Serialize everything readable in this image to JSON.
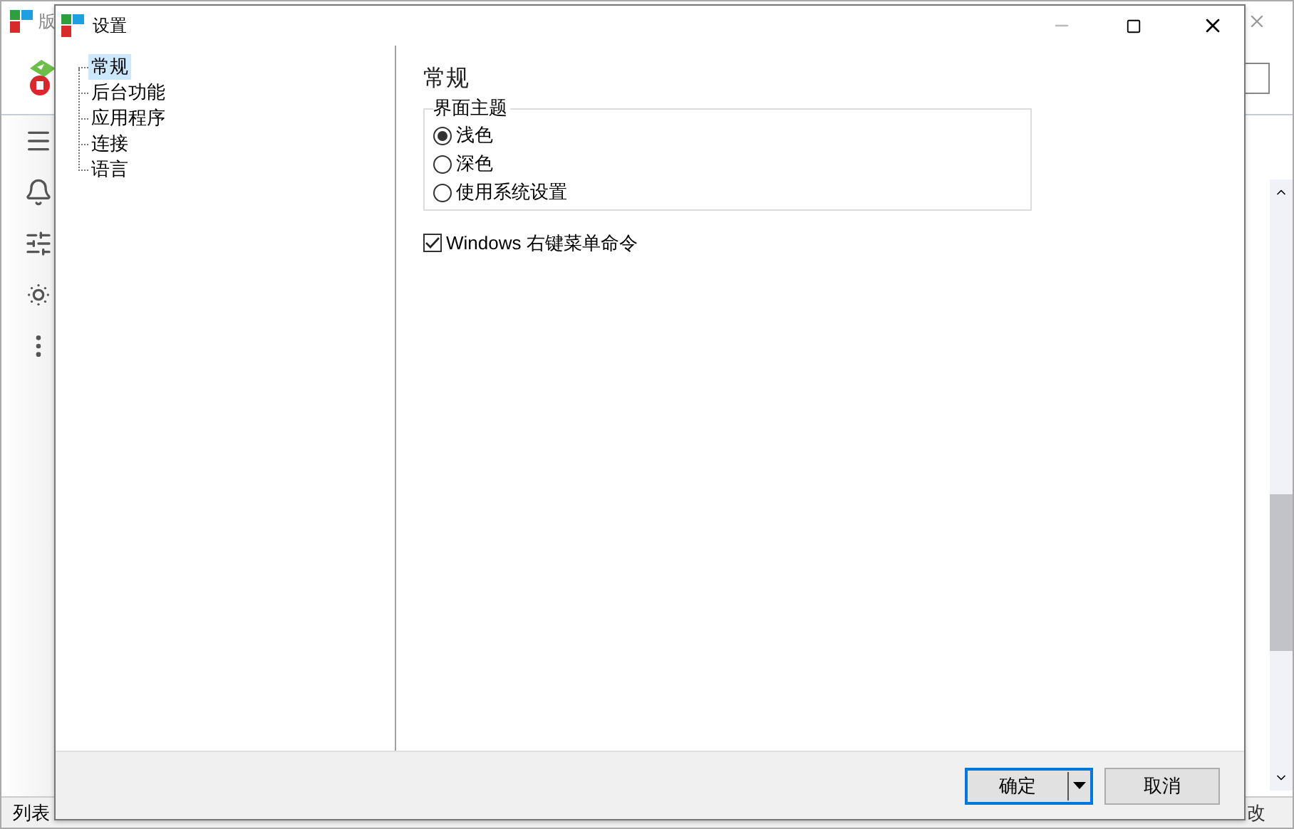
{
  "background_window": {
    "title": "版",
    "status_left": "列表",
    "status_right": "改"
  },
  "dialog": {
    "title": "设置",
    "tree": [
      {
        "label": "常规",
        "selected": true
      },
      {
        "label": "后台功能",
        "selected": false
      },
      {
        "label": "应用程序",
        "selected": false
      },
      {
        "label": "连接",
        "selected": false
      },
      {
        "label": "语言",
        "selected": false
      }
    ],
    "section_title": "常规",
    "group": {
      "title": "界面主题",
      "options": [
        {
          "label": "浅色",
          "selected": true
        },
        {
          "label": "深色",
          "selected": false
        },
        {
          "label": "使用系统设置",
          "selected": false
        }
      ]
    },
    "checkbox": {
      "label": "Windows 右键菜单命令",
      "checked": true
    },
    "buttons": [
      {
        "label": "确定",
        "kind": "split",
        "default": true
      },
      {
        "label": "取消",
        "kind": "plain",
        "default": false
      }
    ]
  }
}
